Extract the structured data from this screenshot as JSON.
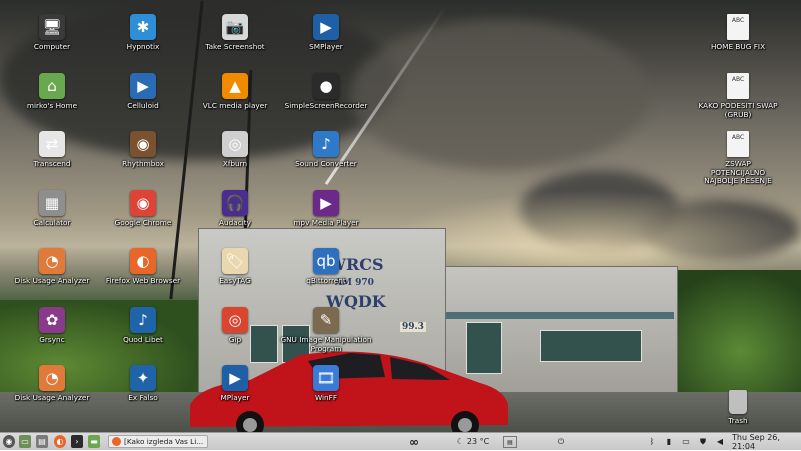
{
  "desktop": {
    "icons": [
      {
        "label": "Computer",
        "glyph": "🖥",
        "icon": "monitor-icon",
        "color": "#3a3a3a"
      },
      {
        "label": "Hypnotix",
        "glyph": "✱",
        "icon": "hypnotix-icon",
        "color": "#2f8fd6"
      },
      {
        "label": "Take Screenshot",
        "glyph": "📷",
        "icon": "camera-icon",
        "color": "#d8d8d8"
      },
      {
        "label": "SMPlayer",
        "glyph": "▶",
        "icon": "smplayer-icon",
        "color": "#1f5fa6"
      },
      {
        "label": "mirko's Home",
        "glyph": "⌂",
        "icon": "home-folder-icon",
        "color": "#6aa84f"
      },
      {
        "label": "Celluloid",
        "glyph": "▶",
        "icon": "celluloid-icon",
        "color": "#2a6bb5"
      },
      {
        "label": "VLC media player",
        "glyph": "▲",
        "icon": "vlc-icon",
        "color": "#f08a00"
      },
      {
        "label": "SimpleScreenRecorder",
        "glyph": "●",
        "icon": "screen-recorder-icon",
        "color": "#2b2b2b"
      },
      {
        "label": "Transcend",
        "glyph": "⇄",
        "icon": "transcend-icon",
        "color": "#e6e6e6"
      },
      {
        "label": "Rhythmbox",
        "glyph": "◉",
        "icon": "rhythmbox-icon",
        "color": "#7a5230"
      },
      {
        "label": "Xfburn",
        "glyph": "◎",
        "icon": "disc-burn-icon",
        "color": "#cfcfcf"
      },
      {
        "label": "Sound Converter",
        "glyph": "♪",
        "icon": "sound-converter-icon",
        "color": "#2f79c9"
      },
      {
        "label": "Calculator",
        "glyph": "▦",
        "icon": "calculator-icon",
        "color": "#8e8e8e"
      },
      {
        "label": "Google Chrome",
        "glyph": "◉",
        "icon": "chrome-icon",
        "color": "#db4437"
      },
      {
        "label": "Audacity",
        "glyph": "🎧",
        "icon": "audacity-icon",
        "color": "#4b2d8f"
      },
      {
        "label": "mpv Media Player",
        "glyph": "▶",
        "icon": "mpv-icon",
        "color": "#6b2a8a"
      },
      {
        "label": "Disk Usage Analyzer",
        "glyph": "◔",
        "icon": "disk-usage-icon",
        "color": "#e07a3a"
      },
      {
        "label": "Firefox Web Browser",
        "glyph": "◐",
        "icon": "firefox-icon",
        "color": "#e8662a"
      },
      {
        "label": "EasyTAG",
        "glyph": "🏷",
        "icon": "easytag-icon",
        "color": "#e9d7b0"
      },
      {
        "label": "qBittorrent",
        "glyph": "qb",
        "icon": "qbittorrent-icon",
        "color": "#2f6fc0"
      },
      {
        "label": "Grsync",
        "glyph": "✿",
        "icon": "grsync-icon",
        "color": "#8a3a8a"
      },
      {
        "label": "Quod Libet",
        "glyph": "♪",
        "icon": "quod-libet-icon",
        "color": "#1f63a8"
      },
      {
        "label": "Gip",
        "glyph": "◎",
        "icon": "gip-icon",
        "color": "#d9452f"
      },
      {
        "label": "GNU Image Manipulation Program",
        "glyph": "✎",
        "icon": "gimp-icon",
        "color": "#7b6a4f"
      },
      {
        "label": "Disk Usage Analyzer",
        "glyph": "◔",
        "icon": "disk-usage-icon",
        "color": "#e07a3a"
      },
      {
        "label": "Ex Falso",
        "glyph": "✦",
        "icon": "ex-falso-icon",
        "color": "#1f63a8"
      },
      {
        "label": "MPlayer",
        "glyph": "▶",
        "icon": "mplayer-icon",
        "color": "#1f5fa6"
      },
      {
        "label": "WinFF",
        "glyph": "🎞",
        "icon": "winff-icon",
        "color": "#3a7bd5"
      }
    ],
    "documents": [
      {
        "label": "HOME BUG FIX",
        "badge": "ABC"
      },
      {
        "label": "KAKO PODESITI SWAP (GRUB)",
        "badge": "ABC"
      },
      {
        "label": "ZSWAP POTENCIJALNO NAJBOLJE RESENJE",
        "badge": "ABC"
      }
    ],
    "trash_label": "Trash"
  },
  "wallpaper": {
    "sign_line1": "WRCS",
    "sign_line2": "AM 970",
    "sign_line3": "WQDK",
    "sign_line4": "99.3"
  },
  "taskbar": {
    "window_title": "[Kako izgleda Vas Li...",
    "temperature": "23 °C",
    "clock": "Thu Sep 26, 21:04",
    "left_icons": [
      "menu-icon",
      "show-desktop-icon",
      "files-icon",
      "firefox-icon",
      "terminal-icon",
      "folder-icon"
    ],
    "center_icon": "glasses-icon",
    "right_icons": [
      "bluetooth-icon",
      "network-icon",
      "clipboard-icon",
      "shield-icon",
      "volume-icon",
      "battery-icon"
    ],
    "colors": {
      "panel": "#d3d3d3",
      "accent": "#2f6fc0"
    }
  }
}
